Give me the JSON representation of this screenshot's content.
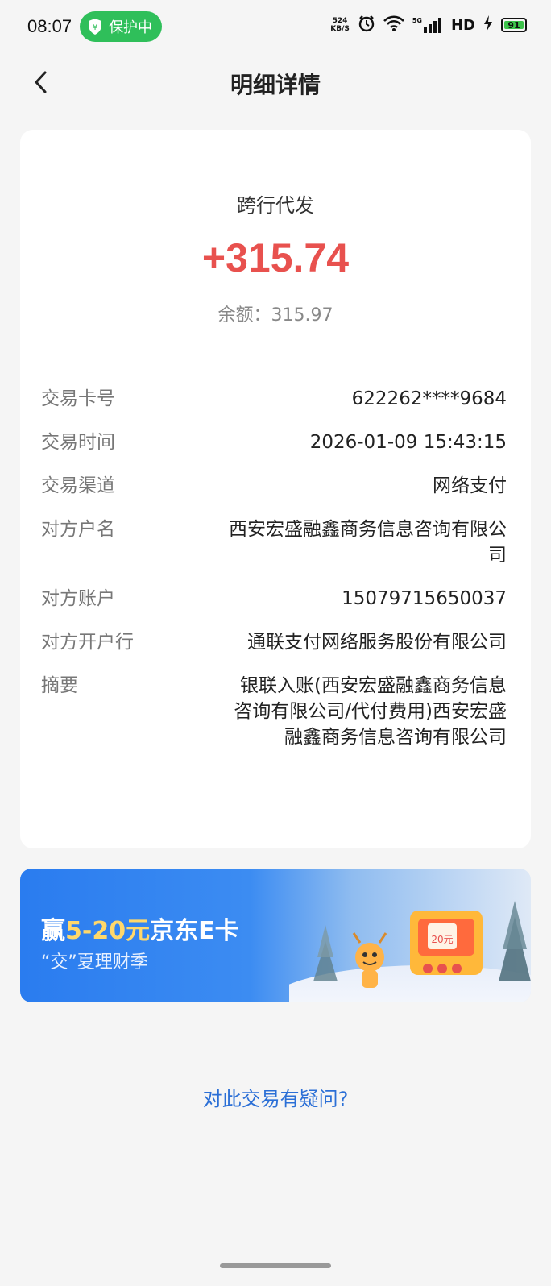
{
  "status_bar": {
    "time": "08:07",
    "protect_label": "保护中",
    "net_speed_value": "524",
    "net_speed_unit": "KB/S",
    "network_label": "HD",
    "signal_label": "5G",
    "battery_level": "91"
  },
  "header": {
    "title": "明细详情"
  },
  "transaction": {
    "type": "跨行代发",
    "amount": "+315.74",
    "balance": "余额：315.97",
    "rows": [
      {
        "label": "交易卡号",
        "value": "622262****9684"
      },
      {
        "label": "交易时间",
        "value": "2026-01-09 15:43:15"
      },
      {
        "label": "交易渠道",
        "value": "网络支付"
      },
      {
        "label": "对方户名",
        "value": "西安宏盛融鑫商务信息咨询有限公司"
      },
      {
        "label": "对方账户",
        "value": "15079715650037"
      },
      {
        "label": "对方开户行",
        "value": "通联支付网络服务股份有限公司"
      },
      {
        "label": "摘要",
        "value": "银联入账(西安宏盛融鑫商务信息咨询有限公司/代付费用)西安宏盛融鑫商务信息咨询有限公司"
      }
    ]
  },
  "banner": {
    "title_prefix": "赢",
    "title_highlight": "5-20元",
    "title_suffix": "京东E卡",
    "subtitle": "“交”夏理财季",
    "badge": "20元"
  },
  "question_link": "对此交易有疑问?",
  "colors": {
    "amount": "#e8514e",
    "link": "#2b6fd6",
    "protect_green": "#2fbf5a"
  }
}
